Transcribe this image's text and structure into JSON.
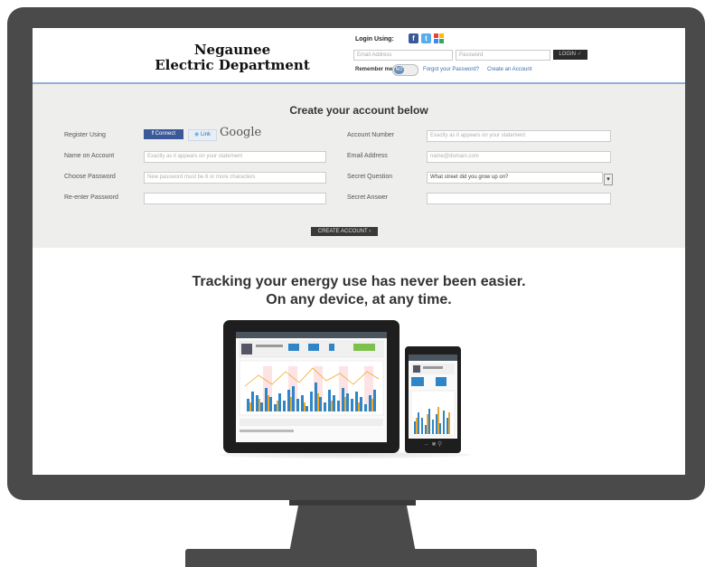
{
  "header": {
    "brand_line1": "Negaunee",
    "brand_line2": "Electric Department",
    "login_using_label": "Login Using:",
    "email_placeholder": "Email Address",
    "password_placeholder": "Password",
    "login_button": "LOGIN",
    "remember_label": "Remember me",
    "toggle_state": "NO",
    "forgot_password_link": "Forgot your Password?",
    "create_account_link": "Create an Account"
  },
  "register": {
    "title": "Create your account below",
    "register_using_label": "Register Using",
    "facebook_button": "Connect",
    "linkedin_button": "Link",
    "google_label": "Google",
    "name_label": "Name on Account",
    "name_placeholder": "Exactly as it appears on your statement",
    "password_label": "Choose Password",
    "password_placeholder": "New password must be 6 or more characters",
    "reenter_label": "Re-enter Password",
    "account_number_label": "Account Number",
    "account_number_placeholder": "Exactly as it appears on your statement",
    "email_label": "Email Address",
    "email_placeholder": "name@domain.com",
    "secret_question_label": "Secret Question",
    "secret_question_value": "What street did you grow up on?",
    "secret_answer_label": "Secret Answer",
    "create_button": "CREATE ACCOUNT"
  },
  "promo": {
    "line1": "Tracking your energy use has never been easier.",
    "line2": "On any device, at any time."
  },
  "colors": {
    "accent_blue": "#8fb0d8",
    "chart_blue": "#2f86c6",
    "chart_orange": "#f2a52b",
    "bezel": "#4a4a4a"
  }
}
